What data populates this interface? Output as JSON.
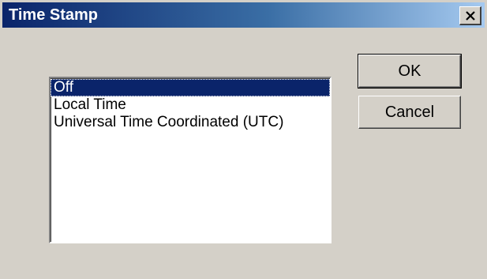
{
  "window": {
    "title": "Time Stamp",
    "close_icon": "close-icon"
  },
  "listbox": {
    "items": [
      "Off",
      "Local Time",
      "Universal Time Coordinated (UTC)"
    ],
    "selected": "Off"
  },
  "buttons": {
    "ok_label": "OK",
    "cancel_label": "Cancel"
  },
  "colors": {
    "titlebar_start": "#0a246a",
    "titlebar_end": "#a6caf0",
    "selection": "#0a246a",
    "face": "#d4d0c8"
  }
}
